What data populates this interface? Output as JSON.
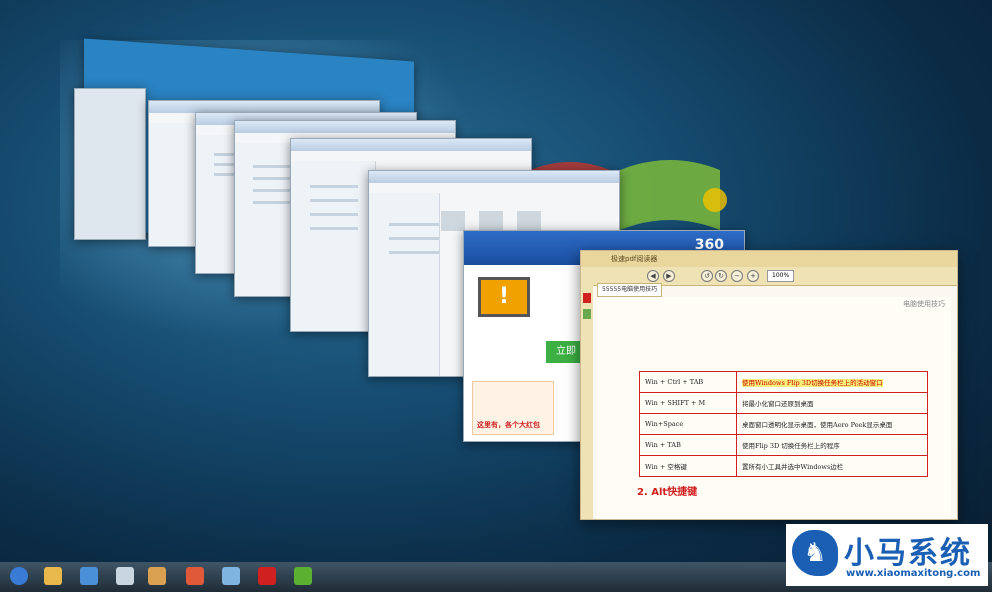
{
  "pdf_reader": {
    "app_title": "极速pdf阅读器",
    "tab_label": "55555电脑使用技巧",
    "zoom": "100%",
    "doc_header": "电脑使用技巧",
    "shortcuts": [
      {
        "key": "Win + Ctrl + TAB",
        "desc": "使用Windows Flip 3D切换任务栏上的活动窗口",
        "highlight": true
      },
      {
        "key": "Win + SHIFT + M",
        "desc": "将最小化窗口还原到桌面",
        "highlight": false
      },
      {
        "key": "Win+Space",
        "desc": "桌面窗口透明化显示桌面，使用Aero Peek显示桌面",
        "highlight": false
      },
      {
        "key": "Win + TAB",
        "desc": "使用Flip 3D 切换任务栏上的程序",
        "highlight": false
      },
      {
        "key": "Win + 空格键",
        "desc": "置所有小工具并选中Windows边栏",
        "highlight": false
      }
    ],
    "section": "2.   Alt快捷键"
  },
  "security_360": {
    "logo": "360",
    "alert": "!",
    "button": "立即",
    "banner_text": "这里有，各个大红包"
  },
  "brand": {
    "name": "小马系统",
    "url": "www.xiaomaxitong.com"
  },
  "colors": {
    "table_border": "#d02020",
    "highlight": "#f6f07a",
    "brand_blue": "#1a5fb4"
  }
}
